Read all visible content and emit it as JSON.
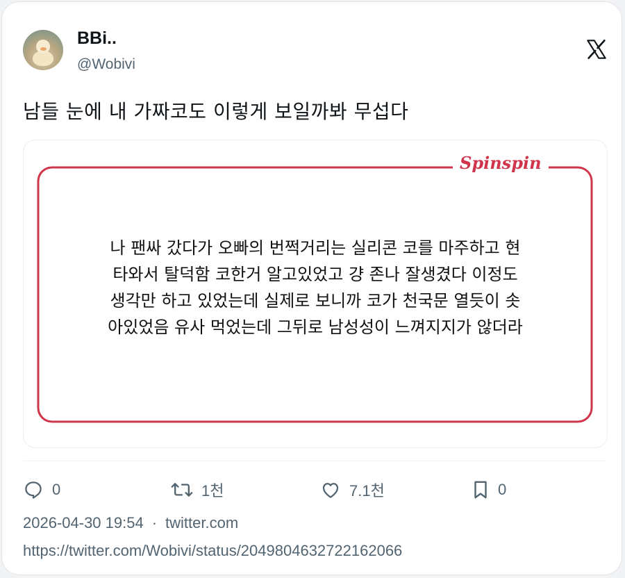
{
  "author": {
    "display_name": "BBi..",
    "handle": "@Wobivi"
  },
  "platform_logo": "x-logo-icon",
  "tweet": {
    "text": "남들 눈에 내 가짜코도 이렇게 보일까봐 무섭다"
  },
  "media": {
    "brand": "Spinspin",
    "accent_color": "#d0354b",
    "lines": [
      "나 팬싸 갔다가 오빠의 번쩍거리는 실리콘 코를 마주하고 현",
      "타와서 탈덕함 코한거 알고있었고 걍 존나 잘생겼다 이정도",
      "생각만 하고 있었는데 실제로 보니까 코가 천국문 열듯이 솟",
      "아있었음 유사 먹었는데 그뒤로 남성성이 느껴지지가 않더라"
    ]
  },
  "actions": {
    "reply_count": "0",
    "retweet_count": "1천",
    "like_count": "7.1천",
    "bookmark_count": "0"
  },
  "meta": {
    "timestamp": "2026-04-30 19:54",
    "separator": "·",
    "source": "twitter.com",
    "url": "https://twitter.com/Wobivi/status/2049804632722162066"
  }
}
